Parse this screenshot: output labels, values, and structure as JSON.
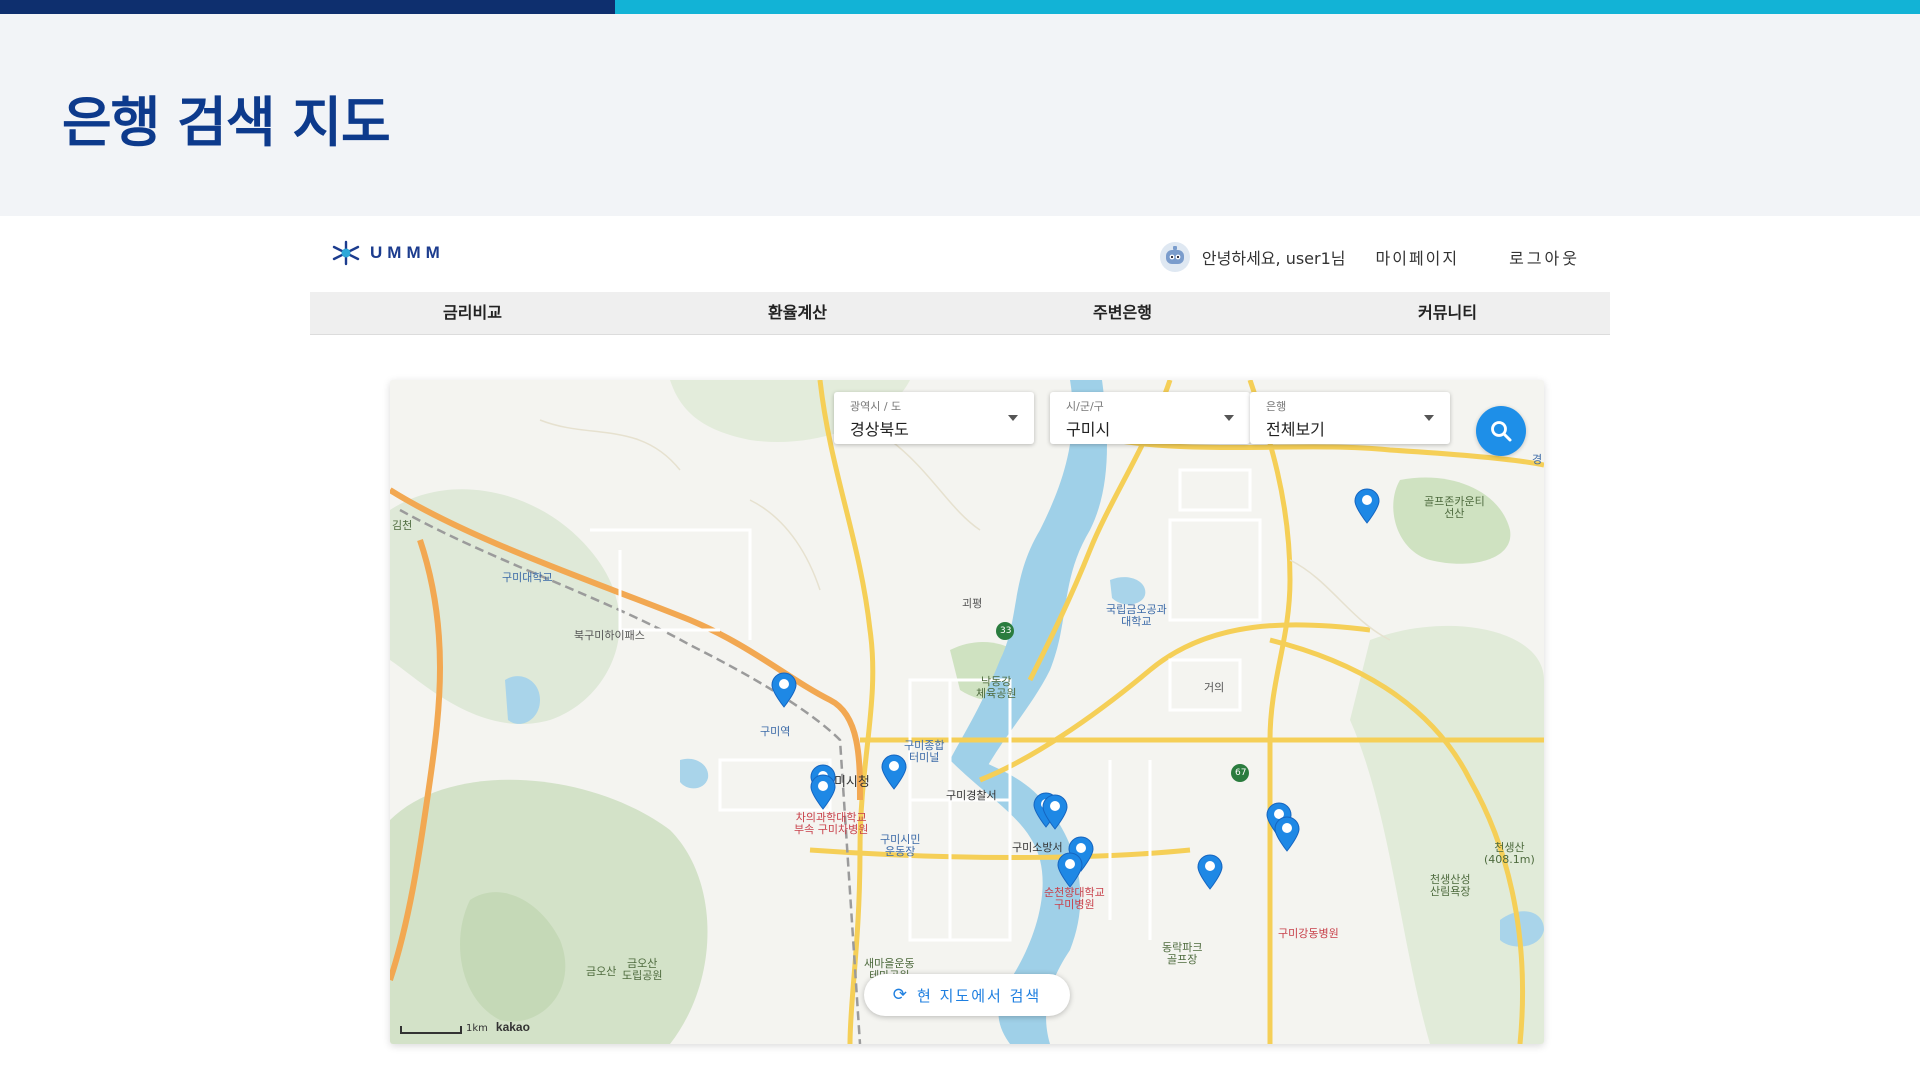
{
  "page": {
    "title": "은행 검색 지도"
  },
  "header": {
    "logo_text": "UMMM",
    "greeting": "안녕하세요, user1님",
    "mypage": "마이페이지",
    "logout": "로그아웃"
  },
  "nav": {
    "items": [
      "금리비교",
      "환율계산",
      "주변은행",
      "커뮤니티"
    ]
  },
  "filters": {
    "province": {
      "label": "광역시 / 도",
      "value": "경상북도"
    },
    "city": {
      "label": "시/군/구",
      "value": "구미시"
    },
    "bank": {
      "label": "은행",
      "value": "전체보기"
    }
  },
  "map": {
    "research_label": "현 지도에서 검색",
    "scale_label": "1km",
    "brand": "kakao",
    "labels": {
      "gimcheon": "김천",
      "gumi_univ": "구미대학교",
      "bukgumi_ic": "북구미하이패스",
      "gumi_station": "구미역",
      "gumi_cityhall": "구미시청",
      "gumi_terminal": "구미종합\n터미널",
      "gumi_police": "구미경찰서",
      "gumi_fire": "구미소방서",
      "cha_hospital": "차의과학대학교\n부속 구미차병원",
      "gumi_stadium": "구미시민\n운동장",
      "soonchunhyang": "순천향대학교\n구미병원",
      "golf_country": "골프존카운티\n선산",
      "kumoh_univ": "국립금오공과\n대학교",
      "nakdong_park": "낙동강\n체육공원",
      "gwapyeong": "괴평",
      "geoui": "거의",
      "cheonsaeng_mt": "천생산\n(408.1m)",
      "cheonsaeng_forest": "천생산성\n산림욕장",
      "gangdong_hospital": "구미강동병원",
      "dongrak_golf": "동락파크\n골프장",
      "geumosan": "금오산",
      "geumosan_park": "금오산\n도립공원",
      "saemaeul": "새마을운동\n테마공원",
      "route33": "33",
      "route67": "67",
      "kyung": "경"
    }
  }
}
